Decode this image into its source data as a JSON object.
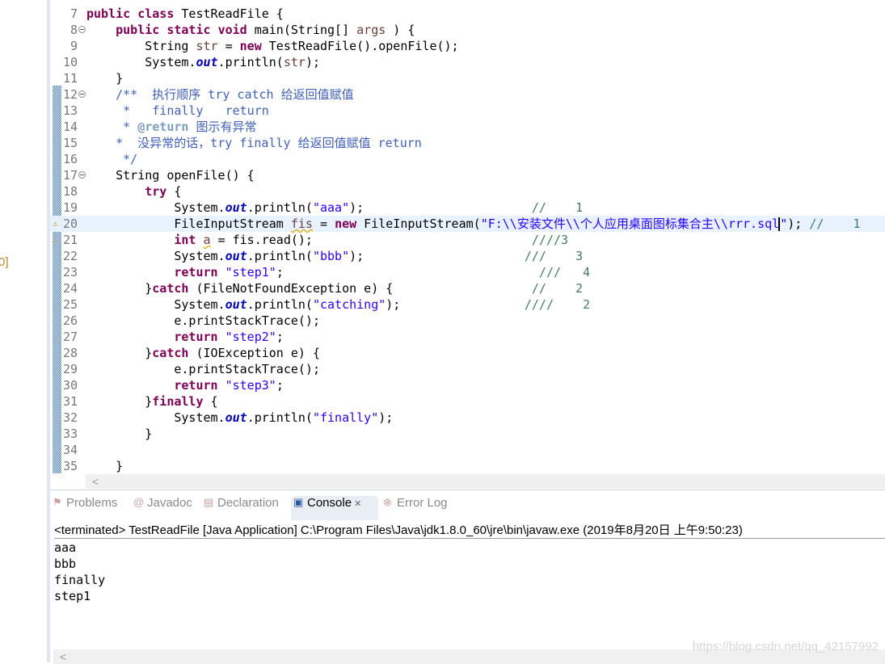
{
  "left_fragment": "0]",
  "editor": {
    "current_line": 20,
    "lines": [
      {
        "n": 7,
        "t": [
          [
            "",
            "public",
            "kw"
          ],
          [
            "",
            " "
          ],
          [
            "",
            "class",
            "kw"
          ],
          [
            "",
            " TestReadFile {"
          ]
        ]
      },
      {
        "n": 8,
        "fold": true,
        "t": [
          [
            "",
            "    "
          ],
          [
            "",
            "public",
            "kw"
          ],
          [
            "",
            " "
          ],
          [
            "",
            "static",
            "kw"
          ],
          [
            "",
            " "
          ],
          [
            "",
            "void",
            "kw"
          ],
          [
            "",
            " main(String[] "
          ],
          [
            "",
            "args",
            "var"
          ],
          [
            "",
            " ) {"
          ]
        ]
      },
      {
        "n": 9,
        "t": [
          [
            "",
            "        String "
          ],
          [
            "",
            "str",
            "var"
          ],
          [
            "",
            " = "
          ],
          [
            "",
            "new",
            "kw"
          ],
          [
            "",
            " TestReadFile().openFile();"
          ]
        ]
      },
      {
        "n": 10,
        "t": [
          [
            "",
            "        System."
          ],
          [
            "",
            "out",
            "fld"
          ],
          [
            "",
            ".println("
          ],
          [
            "",
            "str",
            "var"
          ],
          [
            "",
            ");"
          ]
        ]
      },
      {
        "n": 11,
        "t": [
          [
            "",
            "    }"
          ]
        ]
      },
      {
        "n": 12,
        "fold": true,
        "t": [
          [
            "",
            "    /**  执行顺序 try catch 给返回值赋值",
            "doc"
          ]
        ]
      },
      {
        "n": 13,
        "t": [
          [
            "",
            "     *   finally   return",
            "doc"
          ]
        ]
      },
      {
        "n": 14,
        "t": [
          [
            "",
            "     * ",
            "doc"
          ],
          [
            "",
            "@return",
            "tag"
          ],
          [
            "",
            " 图示有异常",
            "doc"
          ]
        ]
      },
      {
        "n": 15,
        "t": [
          [
            "",
            "    *  没异常的话，try finally 给返回值赋值 return",
            "doc"
          ]
        ]
      },
      {
        "n": 16,
        "t": [
          [
            "",
            "     */",
            "doc"
          ]
        ]
      },
      {
        "n": 17,
        "fold": true,
        "t": [
          [
            "",
            "    String openFile() {"
          ]
        ]
      },
      {
        "n": 18,
        "t": [
          [
            "",
            "        "
          ],
          [
            "",
            "try",
            "kw"
          ],
          [
            "",
            " {"
          ]
        ]
      },
      {
        "n": 19,
        "t": [
          [
            "",
            "            System."
          ],
          [
            "",
            "out",
            "fld"
          ],
          [
            "",
            ".println("
          ],
          [
            "",
            "\"aaa\"",
            "str"
          ],
          [
            "",
            ");                       "
          ],
          [
            "",
            "//    1",
            "cmt"
          ]
        ]
      },
      {
        "n": 20,
        "warn": true,
        "t": [
          [
            "",
            "            FileInputStream "
          ],
          [
            "",
            "fis",
            "warnu"
          ],
          [
            "",
            " = "
          ],
          [
            "",
            "new",
            "kw"
          ],
          [
            "",
            " FileInputStream("
          ],
          [
            "",
            "\"F:\\\\安装文件\\\\个人应用桌面图标集合主\\\\rrr.sql",
            "str"
          ],
          [
            "",
            "",
            "caret"
          ],
          [
            "",
            "\"",
            "str"
          ],
          [
            "",
            "); "
          ],
          [
            "",
            "//    1",
            "cmt"
          ]
        ]
      },
      {
        "n": 21,
        "warn": true,
        "t": [
          [
            "",
            "            "
          ],
          [
            "",
            "int",
            "kw"
          ],
          [
            "",
            " "
          ],
          [
            "",
            "a",
            "warnu"
          ],
          [
            "",
            " = fis.read();                              "
          ],
          [
            "",
            "////3",
            "cmt"
          ]
        ]
      },
      {
        "n": 22,
        "t": [
          [
            "",
            "            System."
          ],
          [
            "",
            "out",
            "fld"
          ],
          [
            "",
            ".println("
          ],
          [
            "",
            "\"bbb\"",
            "str"
          ],
          [
            "",
            ");                      "
          ],
          [
            "",
            "///    3",
            "cmt"
          ]
        ]
      },
      {
        "n": 23,
        "t": [
          [
            "",
            "            "
          ],
          [
            "",
            "return",
            "kw"
          ],
          [
            "",
            " "
          ],
          [
            "",
            "\"step1\"",
            "str"
          ],
          [
            "",
            ";                                   "
          ],
          [
            "",
            "///   4",
            "cmt"
          ]
        ]
      },
      {
        "n": 24,
        "t": [
          [
            "",
            "        }"
          ],
          [
            "",
            "catch",
            "kw"
          ],
          [
            "",
            " (FileNotFoundException e) {                   "
          ],
          [
            "",
            "//    2",
            "cmt"
          ]
        ]
      },
      {
        "n": 25,
        "t": [
          [
            "",
            "            System."
          ],
          [
            "",
            "out",
            "fld"
          ],
          [
            "",
            ".println("
          ],
          [
            "",
            "\"catching\"",
            "str"
          ],
          [
            "",
            ");                 "
          ],
          [
            "",
            "////    2",
            "cmt"
          ]
        ]
      },
      {
        "n": 26,
        "t": [
          [
            "",
            "            e.printStackTrace();"
          ]
        ]
      },
      {
        "n": 27,
        "t": [
          [
            "",
            "            "
          ],
          [
            "",
            "return",
            "kw"
          ],
          [
            "",
            " "
          ],
          [
            "",
            "\"step2\"",
            "str"
          ],
          [
            "",
            ";"
          ]
        ]
      },
      {
        "n": 28,
        "t": [
          [
            "",
            "        }"
          ],
          [
            "",
            "catch",
            "kw"
          ],
          [
            "",
            " (IOException e) {"
          ]
        ]
      },
      {
        "n": 29,
        "t": [
          [
            "",
            "            e.printStackTrace();"
          ]
        ]
      },
      {
        "n": 30,
        "t": [
          [
            "",
            "            "
          ],
          [
            "",
            "return",
            "kw"
          ],
          [
            "",
            " "
          ],
          [
            "",
            "\"step3\"",
            "str"
          ],
          [
            "",
            ";"
          ]
        ]
      },
      {
        "n": 31,
        "t": [
          [
            "",
            "        }"
          ],
          [
            "",
            "finally",
            "kw"
          ],
          [
            "",
            " {"
          ]
        ]
      },
      {
        "n": 32,
        "t": [
          [
            "",
            "            System."
          ],
          [
            "",
            "out",
            "fld"
          ],
          [
            "",
            ".println("
          ],
          [
            "",
            "\"finally\"",
            "str"
          ],
          [
            "",
            ");"
          ]
        ]
      },
      {
        "n": 33,
        "t": [
          [
            "",
            "        }"
          ]
        ]
      },
      {
        "n": 34,
        "t": [
          [
            "",
            ""
          ]
        ]
      },
      {
        "n": 35,
        "t": [
          [
            "",
            "    }"
          ]
        ]
      }
    ]
  },
  "tabs": [
    {
      "label": "Problems",
      "icon": "problems-icon",
      "glyph": "⚑"
    },
    {
      "label": "Javadoc",
      "icon": "at-icon",
      "glyph": "@"
    },
    {
      "label": "Declaration",
      "icon": "declaration-icon",
      "glyph": "▤"
    },
    {
      "label": "Console",
      "icon": "console-icon",
      "glyph": "▣",
      "active": true,
      "close": "✕"
    },
    {
      "label": "Error Log",
      "icon": "error-log-icon",
      "glyph": "⊗"
    }
  ],
  "console": {
    "header": "<terminated> TestReadFile [Java Application] C:\\Program Files\\Java\\jdk1.8.0_60\\jre\\bin\\javaw.exe (2019年8月20日 上午9:50:23)",
    "output": [
      "aaa",
      "bbb",
      "finally",
      "step1"
    ]
  },
  "scroll_arrow": "<",
  "watermark": "https://blog.csdn.net/qq_42157992"
}
